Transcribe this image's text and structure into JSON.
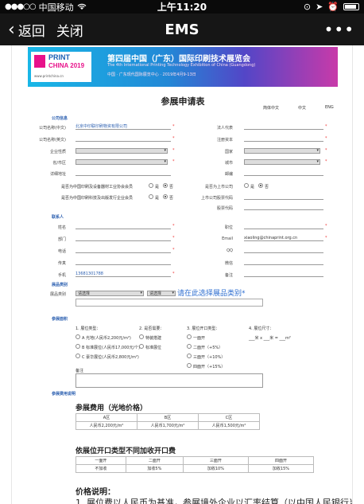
{
  "status": {
    "carrier": "中国移动",
    "wifi": "wifi-icon",
    "time": "上午11:20"
  },
  "nav": {
    "back": "返回",
    "close": "关闭",
    "title": "EMS",
    "more": "•••"
  },
  "banner": {
    "logo_line1": "PRINT",
    "logo_line2": "CHINA 2019",
    "logo_url": "www.printchina.cn",
    "title": "第四届中国（广东）国际印刷技术展览会",
    "subtitle": "The 4th International Printing Technology Exhibition of China (Guangdong)",
    "dates": "中国 · 广东现代国际展览中心 · 2019年4月9-13日"
  },
  "form": {
    "title": "参展申请表",
    "lang": [
      "简体中文",
      "中文",
      "ENG"
    ],
    "sec_company": "公司信息",
    "company_cn_label": "公司名称(中文)",
    "company_cn_value": "北京中印联印刷物资有限公司",
    "company_en_label": "公司名称(英文)",
    "region_label": "企业性质",
    "province_label": "省/市区",
    "address_label": "详细地址",
    "legal_label": "法人代表",
    "reg_capital_label": "注册资本",
    "country_label": "国家",
    "city_label": "城市",
    "zip_label": "邮编",
    "q_member": "是否为中国印刷及设备器材工业协会会员",
    "q_listed": "是否为中国印刷科技及出版发行企业会员",
    "q_public": "是否为上市公司",
    "public_url_label": "上市公司股票代码",
    "stock_code_label": "股票代码",
    "yes": "是",
    "no": "否",
    "sec_contact": "联系人",
    "name_label": "姓名",
    "dept_label": "部门",
    "phone_label": "电话",
    "fax_label": "传真",
    "mobile_label": "手机",
    "mobile_value": "13681301788",
    "title_label": "职位",
    "email_label": "Email",
    "email_value": "xiaoling@chinaprint.org.cn",
    "qq_label": "QQ",
    "wechat_label": "微信",
    "remark_label": "备注",
    "sec_category": "展品类别",
    "cat_label": "展品类别",
    "cat_select1": "请选择",
    "cat_select2": "请选择",
    "cat_hint": "请在此选择展品类别*",
    "sec_booth": "参展面积",
    "booth_q1": "1. 展位类型：",
    "booth_q2": "2. 是否需要：",
    "booth_q3": "3. 展位开口类型：",
    "booth_q4": "4. 展位尺寸：",
    "booth_opt1a": "A 光地(人民币2,200元/m²)",
    "booth_opt1b": "B 标准展位(人民币17,000元/个)",
    "booth_opt1c": "C 豪华展位(人民币2,800元/m²)",
    "booth_opt2a": "特装搭建",
    "booth_opt2b": "标准展位",
    "booth_opt3a": "一面开",
    "booth_opt3b": "二面开（+5%）",
    "booth_opt3c": "三面开（+10%）",
    "booth_opt3d": "四面开（+15%）",
    "size_fill": "___米 x ___米 = ___m²",
    "remark2_label": "备注",
    "sec_other": "参展费用说明",
    "fees_title": "参展费用（光地价格）",
    "fees_head": [
      "A区",
      "B区",
      "C区"
    ],
    "fees_row": [
      "人民币2,200元/m²",
      "人民币1,700元/m²",
      "人民币1,500元/m²"
    ],
    "open_title": "依展位开口类型不同加收开口费",
    "open_head": [
      "一面开",
      "二面开",
      "三面开",
      "四面开"
    ],
    "open_row": [
      "不加收",
      "加收5%",
      "加收10%",
      "加收15%"
    ],
    "price_title": "价格说明：",
    "price_line": "1. 展位费以人民币为基准，参展境外企业以汇率结算（以中国人民银行当日外汇"
  },
  "colors": {
    "navbar": "#161616",
    "link": "#2f6fd0",
    "required": "#e33333"
  }
}
